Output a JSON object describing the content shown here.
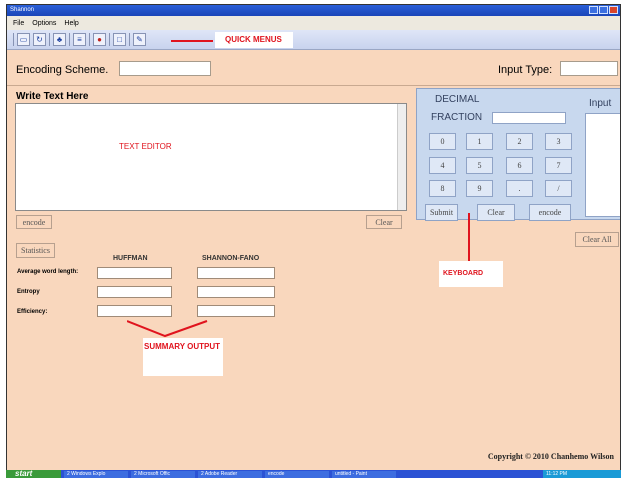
{
  "window": {
    "title": "Shannon"
  },
  "menu": [
    "File",
    "Options",
    "Help"
  ],
  "toolbar": {
    "buttons": [
      "new-icon",
      "refresh-icon",
      "tree-icon",
      "stack-icon",
      "stop-icon",
      "page-icon",
      "edit-icon"
    ],
    "annotation": "QUICK MENUS"
  },
  "encoding": {
    "label": "Encoding Scheme.",
    "value": ""
  },
  "input_type": {
    "label": "Input Type:",
    "value": ""
  },
  "editor": {
    "label": "Write Text Here",
    "annotation": "TEXT EDITOR",
    "value": ""
  },
  "buttons": {
    "encode": "encode",
    "clear": "Clear",
    "statistics": "Statistics",
    "clear_all": "Clear All"
  },
  "keypad": {
    "title": "DECIMAL",
    "fraction_label": "FRACTION",
    "input_label": "Input",
    "keys": [
      "0",
      "1",
      "2",
      "3",
      "4",
      "5",
      "6",
      "7",
      "8",
      "9",
      ".",
      "/"
    ],
    "submit": "Submit",
    "clear": "Clear",
    "encode": "encode",
    "annotation": "KEYBOARD"
  },
  "stats": {
    "columns": [
      "HUFFMAN",
      "SHANNON-FANO"
    ],
    "rows": [
      "Average word length:",
      "Entropy",
      "Efficiency:"
    ],
    "annotation": "SUMMARY OUTPUT"
  },
  "copyright": "Copyright © 2010 Chanhemo Wilson",
  "taskbar": {
    "start": "start",
    "items": [
      "2 Windows Explo",
      "2 Microsoft Offic",
      "2 Adobe Reader",
      "encode",
      "untitled - Paint"
    ],
    "clock": "11:12 PM"
  },
  "colors": {
    "background": "#f9d7bd",
    "keypad": "#c8d8ee",
    "annotation": "#e0141e",
    "titlebar": "#1a45b8"
  }
}
